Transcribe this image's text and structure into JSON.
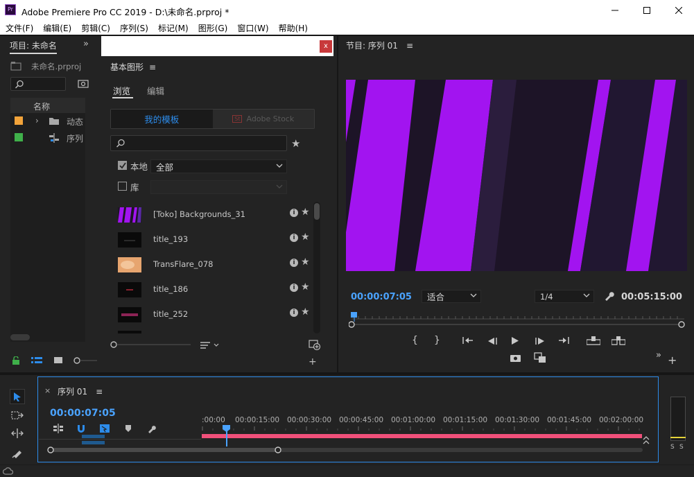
{
  "window": {
    "app_icon_text": "Pr",
    "title": "Adobe Premiere Pro CC 2019 - D:\\未命名.prproj *"
  },
  "menu": [
    "文件(F)",
    "编辑(E)",
    "剪辑(C)",
    "序列(S)",
    "标记(M)",
    "图形(G)",
    "窗口(W)",
    "帮助(H)"
  ],
  "project": {
    "title": "项目: 未命名",
    "file": "未命名.prproj",
    "column_name": "名称",
    "items": [
      {
        "label": "动态",
        "color": "#f2a33a",
        "icon": "folder-icon"
      },
      {
        "label": "序列",
        "color": "#3fb04a",
        "icon": "sequence-icon"
      }
    ]
  },
  "essential_graphics": {
    "close_label": "x",
    "title": "基本图形",
    "tabs": [
      "浏览",
      "编辑"
    ],
    "seg_mine": "我的模板",
    "seg_stock": "Adobe Stock",
    "stock_badge": "St",
    "local_label": "本地",
    "local_value": "全部",
    "library_label": "库",
    "templates": [
      {
        "name": "[Toko] Backgrounds_31",
        "thumb": "purple"
      },
      {
        "name": "title_193",
        "thumb": "dark-line"
      },
      {
        "name": "TransFlare_078",
        "thumb": "peach"
      },
      {
        "name": "title_186",
        "thumb": "dark-red"
      },
      {
        "name": "title_252",
        "thumb": "dark-pink"
      }
    ]
  },
  "program_monitor": {
    "title": "节目: 序列 01",
    "timecode": "00:00:07:05",
    "fit": "适合",
    "resolution": "1/4",
    "duration": "00:05:15:00"
  },
  "timeline": {
    "close_label": "×",
    "title": "序列 01",
    "timecode": "00:00:07:05",
    "ruler": [
      ":00:00",
      "00:00:15:00",
      "00:00:30:00",
      "00:00:45:00",
      "00:01:00:00",
      "00:01:15:00",
      "00:01:30:00",
      "00:01:45:00",
      "00:02:00:00"
    ]
  },
  "meter": {
    "solo_left": "S",
    "solo_right": "S"
  },
  "colors": {
    "accent": "#2d8ceb",
    "timecode": "#4aa3ff",
    "workbar": "#f0507a",
    "video_stripe": "#a214f0"
  }
}
